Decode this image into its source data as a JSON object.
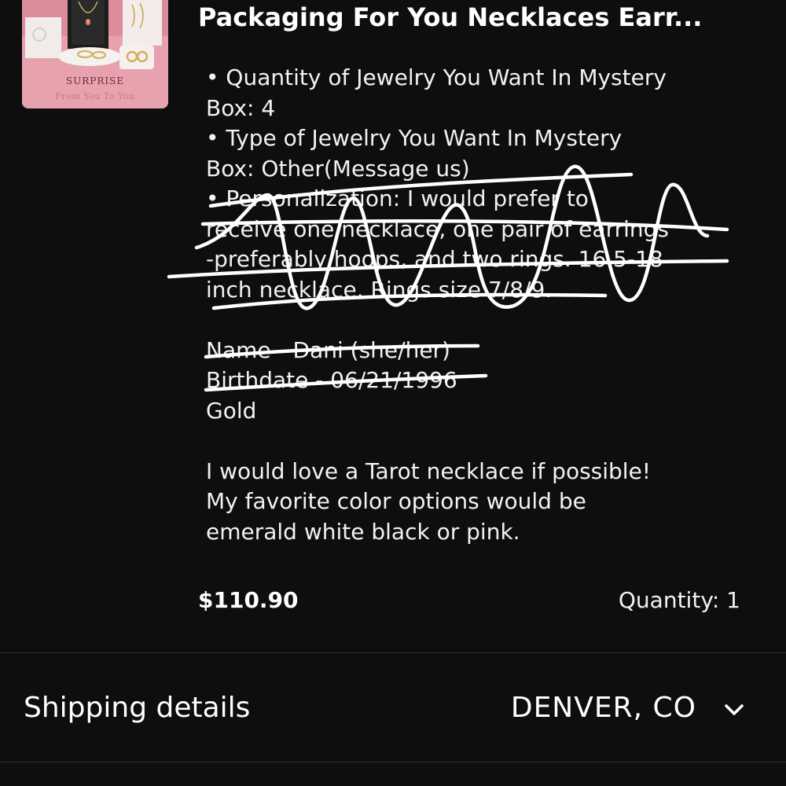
{
  "order_item": {
    "thumbnail": {
      "brand_text": "SURPRISE",
      "tagline": "From You To You"
    },
    "title": "Packaging For You Necklaces Earr...",
    "lines": [
      "• Quantity of Jewelry You Want In Mystery",
      "Box: 4",
      "• Type of Jewelry You Want In Mystery",
      "Box: Other(Message us)",
      "• Personalization: I would prefer to",
      "receive one necklace, one pair of earrings",
      "-preferably hoops, and two rings. 16.5-18",
      "inch necklace. Rings size 7/8/9.",
      "",
      "Name - Dani (she/her)",
      "Birthdate - 06/21/1996",
      "Gold",
      "",
      "I would love a Tarot necklace if possible!",
      "My favorite color options would be",
      "emerald white black or pink."
    ],
    "price": "$110.90",
    "quantity_label": "Quantity: 1"
  },
  "shipping": {
    "label": "Shipping details",
    "value": "DENVER, CO",
    "icon": "chevron-down-icon"
  },
  "colors": {
    "background": "#0e0e0e",
    "divider": "#2c2c2c",
    "text": "#ffffff",
    "thumbnail_pink": "#e59aa8"
  }
}
